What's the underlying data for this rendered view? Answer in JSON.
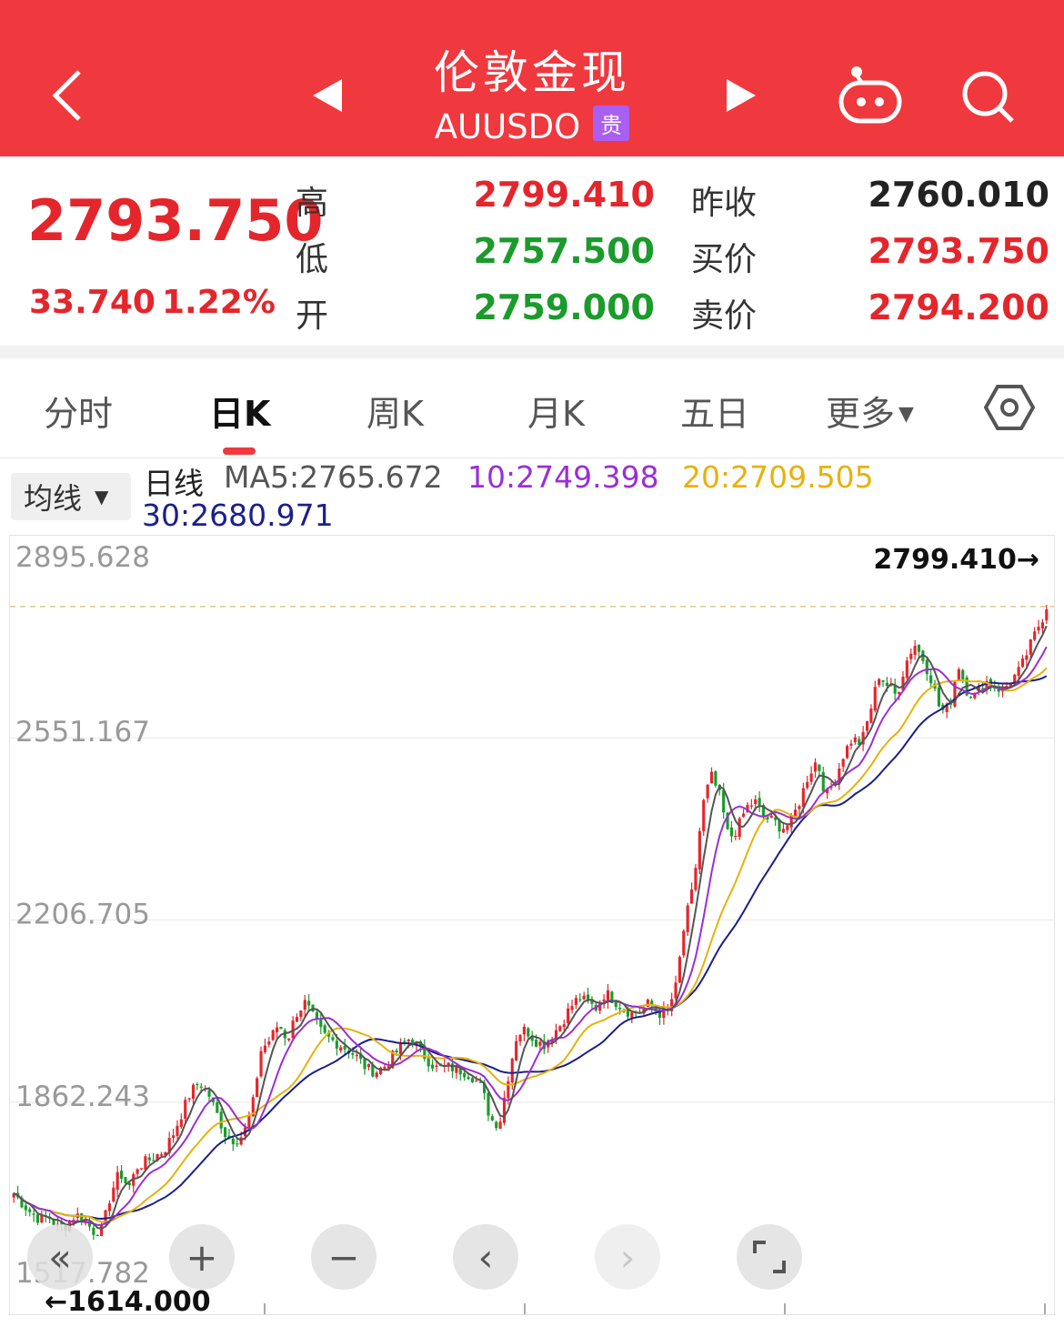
{
  "header": {
    "back_icon": "chevron-left-icon",
    "prev_icon": "triangle-left-icon",
    "next_icon": "triangle-right-icon",
    "robot_icon": "robot-icon",
    "search_icon": "search-icon",
    "title": "伦敦金现",
    "code": "AUUSDO",
    "badge": "贵"
  },
  "quote": {
    "last": "2793.750",
    "change": "33.740",
    "change_pct": "1.22%",
    "high_label": "高",
    "high": "2799.410",
    "low_label": "低",
    "low": "2757.500",
    "open_label": "开",
    "open": "2759.000",
    "prev_close_label": "昨收",
    "prev_close": "2760.010",
    "bid_label": "买价",
    "bid": "2793.750",
    "ask_label": "卖价",
    "ask": "2794.200"
  },
  "tabs": [
    {
      "label": "分时"
    },
    {
      "label": "日K"
    },
    {
      "label": "周K"
    },
    {
      "label": "月K"
    },
    {
      "label": "五日"
    },
    {
      "label": "更多"
    }
  ],
  "settings_icon": "hexagon-gear-icon",
  "ma": {
    "select_label": "均线",
    "title": "日线",
    "ma5": "MA5:2765.672",
    "ma10": "10:2749.398",
    "ma20": "20:2709.505",
    "ma30": "30:2680.971",
    "colors": {
      "ma5": "#555555",
      "ma10": "#9b2fd6",
      "ma20": "#e8b10c",
      "ma30": "#1b1f8a"
    }
  },
  "chart_data": {
    "type": "candlestick",
    "y_ticks": [
      "2895.628",
      "2551.167",
      "2206.705",
      "1862.243",
      "1517.782"
    ],
    "ylim": [
      1517.782,
      2895.628
    ],
    "max_marker": "2799.410→",
    "min_marker": "←1614.000",
    "max_value": 2799.41,
    "min_value": 1614.0,
    "colors": {
      "up": "#e4262c",
      "down": "#1a9b2b",
      "ref_line": "#d9c98a"
    },
    "close_path": [
      1690,
      1670,
      1652,
      1640,
      1645,
      1625,
      1630,
      1650,
      1640,
      1618,
      1620,
      1690,
      1730,
      1700,
      1740,
      1750,
      1760,
      1770,
      1800,
      1840,
      1880,
      1900,
      1880,
      1840,
      1800,
      1790,
      1800,
      1850,
      1960,
      1980,
      2010,
      1980,
      2030,
      2050,
      2020,
      1990,
      1980,
      1970,
      1960,
      1945,
      1925,
      1920,
      1930,
      1950,
      1970,
      1985,
      1960,
      1940,
      1925,
      1930,
      1925,
      1920,
      1910,
      1890,
      1830,
      1820,
      1910,
      1990,
      2000,
      1980,
      1970,
      1990,
      2010,
      2040,
      2060,
      2050,
      2040,
      2070,
      2055,
      2040,
      2030,
      2035,
      2050,
      2030,
      2030,
      2080,
      2200,
      2270,
      2420,
      2480,
      2440,
      2360,
      2380,
      2420,
      2430,
      2400,
      2395,
      2380,
      2390,
      2430,
      2480,
      2510,
      2440,
      2470,
      2520,
      2550,
      2540,
      2600,
      2670,
      2650,
      2630,
      2690,
      2730,
      2700,
      2660,
      2600,
      2610,
      2690,
      2640,
      2630,
      2660,
      2650,
      2640,
      2660,
      2680,
      2720,
      2760,
      2794
    ],
    "ma5": "MA5:2765.672",
    "ma10": "10:2749.398",
    "ma20": "20:2709.505",
    "ma30": "30:2680.971"
  },
  "controls": {
    "collapse_icon": "double-chevron-left-icon",
    "zoom_in_icon": "plus-icon",
    "zoom_out_icon": "minus-icon",
    "prev_icon": "chevron-left-icon",
    "next_icon": "chevron-right-icon",
    "fullscreen_icon": "fullscreen-icon"
  }
}
